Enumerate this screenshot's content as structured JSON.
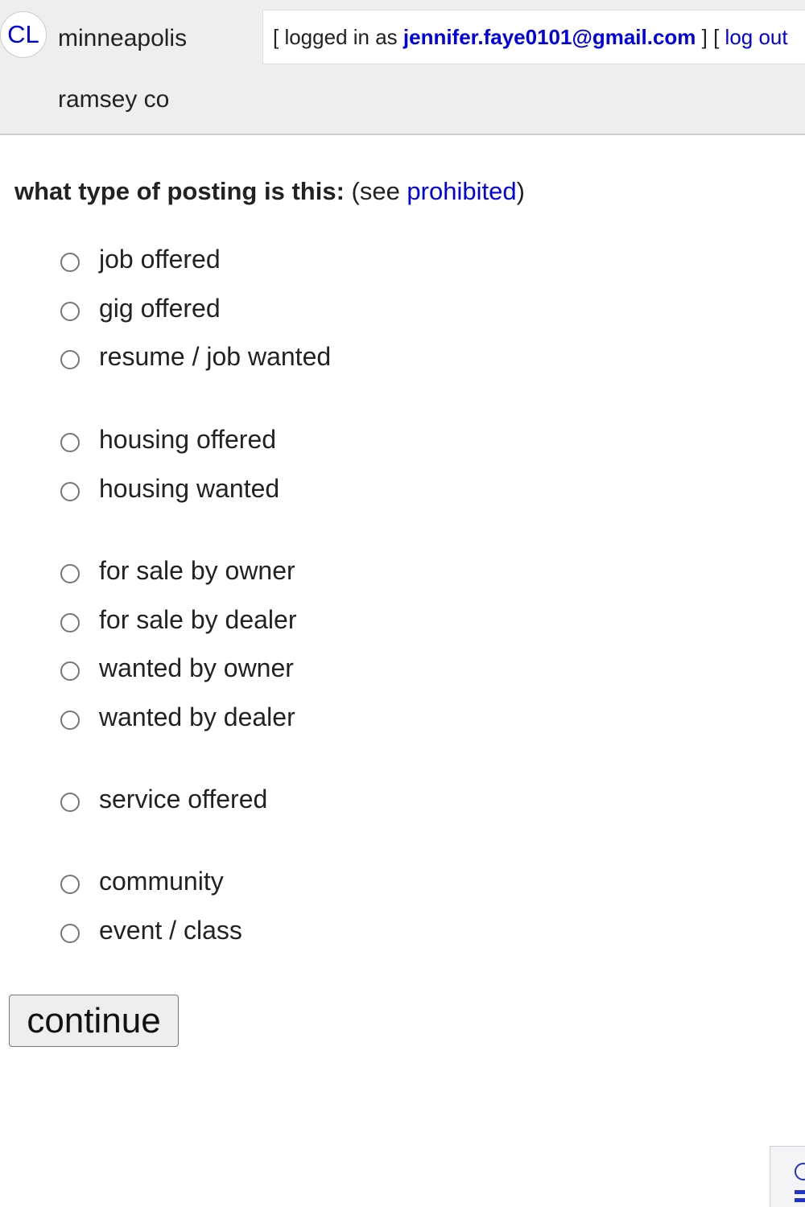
{
  "header": {
    "logo_text": "CL",
    "area": "minneapolis",
    "subarea": "ramsey co",
    "user_bar": {
      "prefix": "[ logged in as ",
      "email": "jennifer.faye0101@gmail.com",
      "middle": " ] [ ",
      "logout": "log out"
    }
  },
  "form": {
    "question_bold": "what type of posting is this:",
    "question_see": " (see ",
    "prohibited_link": "prohibited",
    "question_close": ")",
    "options": [
      {
        "label": "job offered",
        "selected": false
      },
      {
        "label": "gig offered",
        "selected": false
      },
      {
        "label": "resume / job wanted",
        "selected": false
      },
      {
        "label": "housing offered",
        "selected": false
      },
      {
        "label": "housing wanted",
        "selected": false
      },
      {
        "label": "for sale by owner",
        "selected": false
      },
      {
        "label": "for sale by dealer",
        "selected": false
      },
      {
        "label": "wanted by owner",
        "selected": false
      },
      {
        "label": "wanted by dealer",
        "selected": false
      },
      {
        "label": "service offered",
        "selected": false
      },
      {
        "label": "community",
        "selected": false
      },
      {
        "label": "event / class",
        "selected": false
      }
    ],
    "continue_label": "continue"
  },
  "colors": {
    "link": "#0000dd",
    "header_bg": "#eeeeee"
  }
}
